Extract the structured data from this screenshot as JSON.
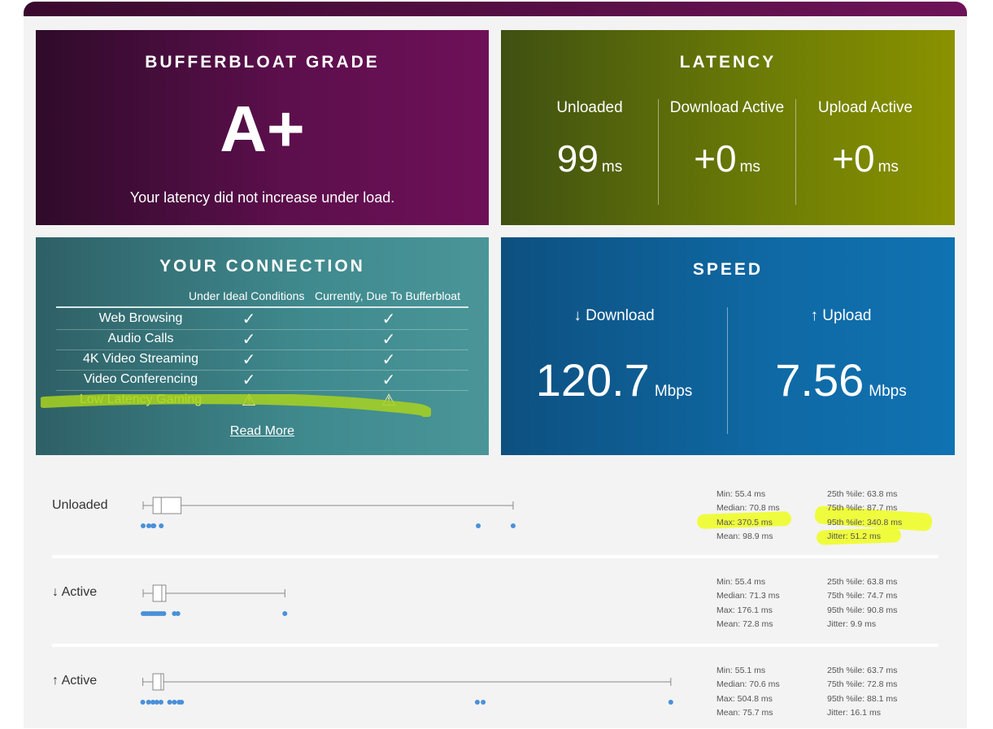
{
  "grade": {
    "title": "BUFFERBLOAT GRADE",
    "letter": "A+",
    "subtitle": "Your latency did not increase under load."
  },
  "latency": {
    "title": "LATENCY",
    "cols": [
      {
        "label": "Unloaded",
        "value": "99",
        "unit": "ms"
      },
      {
        "label": "Download Active",
        "value": "+0",
        "unit": "ms"
      },
      {
        "label": "Upload Active",
        "value": "+0",
        "unit": "ms"
      }
    ]
  },
  "connection": {
    "title": "YOUR CONNECTION",
    "col1": "Under Ideal Conditions",
    "col2": "Currently, Due To Bufferbloat",
    "rows": [
      {
        "label": "Web Browsing",
        "ideal": "✓",
        "current": "✓"
      },
      {
        "label": "Audio Calls",
        "ideal": "✓",
        "current": "✓"
      },
      {
        "label": "4K Video Streaming",
        "ideal": "✓",
        "current": "✓"
      },
      {
        "label": "Video Conferencing",
        "ideal": "✓",
        "current": "✓"
      },
      {
        "label": "Low Latency Gaming",
        "ideal": "⚠",
        "current": "⚠"
      }
    ],
    "read_more": "Read More"
  },
  "speed": {
    "title": "SPEED",
    "cols": [
      {
        "label": "↓ Download",
        "value": "120.7",
        "unit": "Mbps"
      },
      {
        "label": "↑ Upload",
        "value": "7.56",
        "unit": "Mbps"
      }
    ]
  },
  "colors": {
    "grade": "#5c0f4c",
    "latency": "#6a7a06",
    "connection": "#3f8a8e",
    "speed": "#0f69a4",
    "dots": "#4a90d9",
    "highlight": "#eeff00"
  },
  "boxplots": [
    {
      "label": "Unloaded",
      "min": 55.4,
      "q1": 63.8,
      "median": 70.8,
      "q3": 87.7,
      "p95": 340.8,
      "max": 370.5,
      "outliers": [
        55.4,
        60.2,
        63.8,
        64.5,
        70.8,
        340.8,
        370.5
      ],
      "stats_left": [
        "Min: 55.4 ms",
        "Median: 70.8 ms",
        "Max: 370.5 ms",
        "Mean: 98.9 ms"
      ],
      "stats_right": [
        "25th %ile: 63.8 ms",
        "75th %ile: 87.7 ms",
        "95th %ile: 340.8 ms",
        "Jitter: 51.2 ms"
      ]
    },
    {
      "label": "↓ Active",
      "min": 55.4,
      "q1": 63.8,
      "median": 71.3,
      "q3": 74.7,
      "p95": 90.8,
      "max": 176.1,
      "outliers": [
        55.4,
        57,
        59,
        61,
        63,
        65,
        67,
        69,
        71,
        73,
        82,
        85,
        176.1
      ],
      "stats_left": [
        "Min: 55.4 ms",
        "Median: 71.3 ms",
        "Max: 176.1 ms",
        "Mean: 72.8 ms"
      ],
      "stats_right": [
        "25th %ile: 63.8 ms",
        "75th %ile: 74.7 ms",
        "95th %ile: 90.8 ms",
        "Jitter: 9.9 ms"
      ]
    },
    {
      "label": "↑ Active",
      "min": 55.1,
      "q1": 63.7,
      "median": 70.6,
      "q3": 72.8,
      "p95": 88.1,
      "max": 504.8,
      "outliers": [
        55.1,
        60,
        63.7,
        67,
        70.6,
        78,
        82,
        86,
        88.1,
        340,
        345,
        504.8
      ],
      "stats_left": [
        "Min: 55.1 ms",
        "Median: 70.6 ms",
        "Max: 504.8 ms",
        "Mean: 75.7 ms"
      ],
      "stats_right": [
        "25th %ile: 63.7 ms",
        "75th %ile: 72.8 ms",
        "95th %ile: 88.1 ms",
        "Jitter: 16.1 ms"
      ]
    }
  ]
}
